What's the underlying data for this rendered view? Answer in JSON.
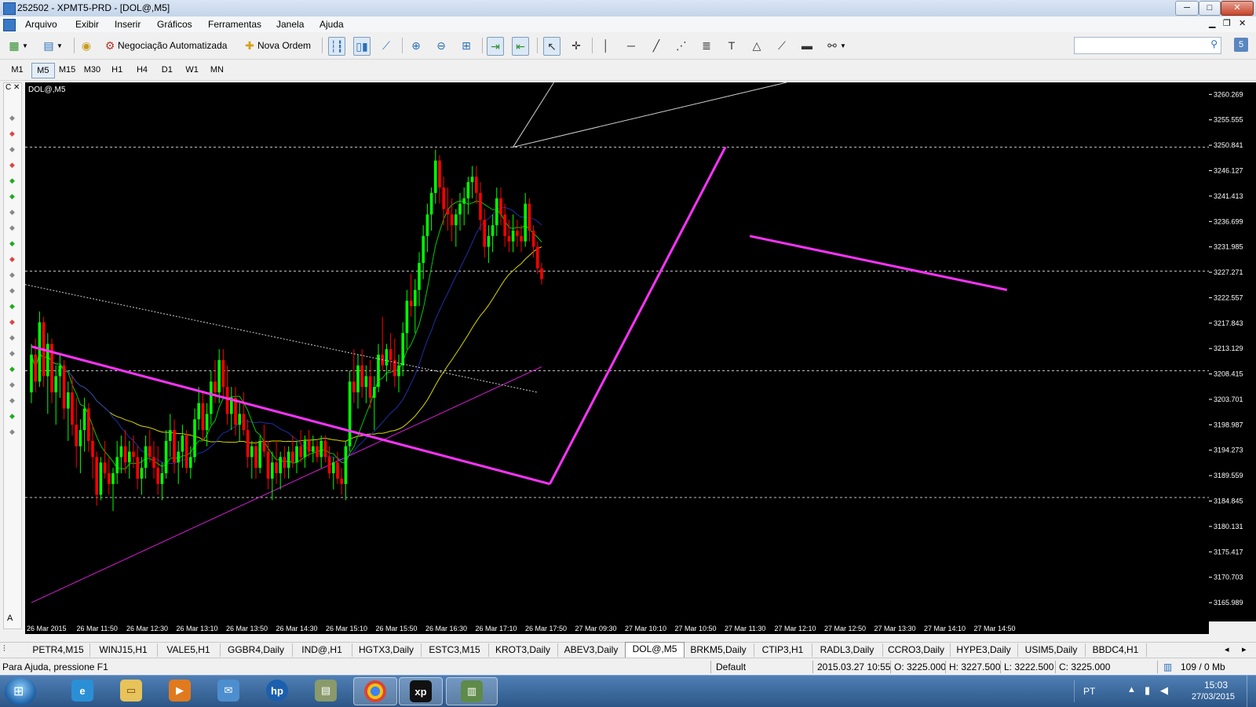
{
  "window": {
    "title": "252502 - XPMT5-PRD - [DOL@,M5]",
    "min_label": "─",
    "max_label": "□",
    "close_label": "✕"
  },
  "menu": [
    "Arquivo",
    "Exibir",
    "Inserir",
    "Gráficos",
    "Ferramentas",
    "Janela",
    "Ajuda"
  ],
  "toolbar": {
    "auto_trading_label": "Negociação Automatizada",
    "new_order_label": "Nova Ordem",
    "search_placeholder": ""
  },
  "timeframes": {
    "items": [
      "M1",
      "M5",
      "M15",
      "M30",
      "H1",
      "H4",
      "D1",
      "W1",
      "MN"
    ],
    "selected": "M5"
  },
  "chart_data": {
    "type": "candlestick",
    "symbol_label": "DOL@,M5",
    "y_ticks": [
      3260.269,
      3255.555,
      3250.841,
      3246.127,
      3241.413,
      3236.699,
      3231.985,
      3227.271,
      3222.557,
      3217.843,
      3213.129,
      3208.415,
      3203.701,
      3198.987,
      3194.273,
      3189.559,
      3184.845,
      3180.131,
      3175.417,
      3170.703,
      3165.989
    ],
    "ylim": [
      3162.5,
      3262.5
    ],
    "x_labels": [
      "26 Mar 2015",
      "26 Mar 11:50",
      "26 Mar 12:30",
      "26 Mar 13:10",
      "26 Mar 13:50",
      "26 Mar 14:30",
      "26 Mar 15:10",
      "26 Mar 15:50",
      "26 Mar 16:30",
      "26 Mar 17:10",
      "26 Mar 17:50",
      "27 Mar 09:30",
      "27 Mar 10:10",
      "27 Mar 10:50",
      "27 Mar 11:30",
      "27 Mar 12:10",
      "27 Mar 12:50",
      "27 Mar 13:30",
      "27 Mar 14:10",
      "27 Mar 14:50"
    ],
    "horizontal_levels": [
      3250.5,
      3227.5,
      3209.0,
      3185.5
    ],
    "colors": {
      "bull": "#00ff00",
      "bear": "#ff0000",
      "ma_fast": "#00cc00",
      "ma_mid": "#1e2fa8",
      "ma_slow": "#d8d800",
      "ma_long": "#d81ed8",
      "trend": "#ff33ff",
      "grid_dash": "#c0c0c0"
    },
    "trendlines": [
      {
        "name": "falling-trendline",
        "x": [
          0,
          127
        ],
        "y": [
          3213.5,
          3188.0
        ]
      },
      {
        "name": "rising-trendline",
        "x": [
          127,
          170
        ],
        "y": [
          3188.0,
          3250.5
        ]
      },
      {
        "name": "flag-trendline",
        "x": [
          176,
          239
        ],
        "y": [
          3234.0,
          3224.0
        ]
      }
    ],
    "candles_ohlc": [
      [
        3205,
        3214,
        3203,
        3212
      ],
      [
        3212,
        3215,
        3205,
        3207
      ],
      [
        3207,
        3220,
        3206,
        3218
      ],
      [
        3218,
        3219,
        3206,
        3208
      ],
      [
        3208,
        3216,
        3201,
        3214
      ],
      [
        3214,
        3215,
        3203,
        3205
      ],
      [
        3205,
        3210,
        3199,
        3208
      ],
      [
        3208,
        3212,
        3204,
        3210
      ],
      [
        3210,
        3211,
        3200,
        3202
      ],
      [
        3202,
        3207,
        3196,
        3205
      ],
      [
        3205,
        3208,
        3197,
        3199
      ],
      [
        3199,
        3204,
        3191,
        3195
      ],
      [
        3195,
        3200,
        3190,
        3198
      ],
      [
        3198,
        3204,
        3194,
        3202
      ],
      [
        3202,
        3203,
        3194,
        3196
      ],
      [
        3196,
        3199,
        3189,
        3193
      ],
      [
        3193,
        3194,
        3184,
        3186
      ],
      [
        3186,
        3193,
        3185,
        3192
      ],
      [
        3192,
        3196,
        3189,
        3190
      ],
      [
        3190,
        3193,
        3186,
        3188
      ],
      [
        3188,
        3191,
        3183,
        3190
      ],
      [
        3190,
        3196,
        3188,
        3193
      ],
      [
        3193,
        3197,
        3190,
        3195
      ],
      [
        3195,
        3198,
        3190,
        3192
      ],
      [
        3192,
        3196,
        3189,
        3194
      ],
      [
        3194,
        3197,
        3191,
        3193
      ],
      [
        3193,
        3195,
        3187,
        3189
      ],
      [
        3189,
        3193,
        3186,
        3191
      ],
      [
        3191,
        3197,
        3189,
        3195
      ],
      [
        3195,
        3198,
        3192,
        3193
      ],
      [
        3193,
        3196,
        3189,
        3191
      ],
      [
        3191,
        3195,
        3186,
        3188
      ],
      [
        3188,
        3192,
        3185,
        3190
      ],
      [
        3190,
        3198,
        3189,
        3196
      ],
      [
        3196,
        3201,
        3193,
        3198
      ],
      [
        3198,
        3200,
        3190,
        3192
      ],
      [
        3192,
        3196,
        3188,
        3194
      ],
      [
        3194,
        3199,
        3191,
        3197
      ],
      [
        3197,
        3198,
        3190,
        3191
      ],
      [
        3191,
        3195,
        3189,
        3193
      ],
      [
        3193,
        3202,
        3192,
        3200
      ],
      [
        3200,
        3206,
        3198,
        3203
      ],
      [
        3203,
        3205,
        3196,
        3198
      ],
      [
        3198,
        3203,
        3195,
        3201
      ],
      [
        3201,
        3209,
        3199,
        3207
      ],
      [
        3207,
        3211,
        3203,
        3205
      ],
      [
        3205,
        3213,
        3203,
        3211
      ],
      [
        3211,
        3213,
        3204,
        3206
      ],
      [
        3206,
        3210,
        3199,
        3201
      ],
      [
        3201,
        3206,
        3198,
        3204
      ],
      [
        3204,
        3206,
        3197,
        3199
      ],
      [
        3199,
        3203,
        3196,
        3201
      ],
      [
        3201,
        3205,
        3197,
        3198
      ],
      [
        3198,
        3200,
        3191,
        3193
      ],
      [
        3193,
        3196,
        3189,
        3195
      ],
      [
        3195,
        3196,
        3189,
        3191
      ],
      [
        3191,
        3197,
        3190,
        3196
      ],
      [
        3196,
        3199,
        3193,
        3194
      ],
      [
        3194,
        3196,
        3187,
        3189
      ],
      [
        3189,
        3194,
        3185,
        3192
      ],
      [
        3192,
        3196,
        3188,
        3190
      ],
      [
        3190,
        3194,
        3187,
        3193
      ],
      [
        3193,
        3195,
        3189,
        3191
      ],
      [
        3191,
        3195,
        3189,
        3194
      ],
      [
        3194,
        3197,
        3191,
        3192
      ],
      [
        3192,
        3196,
        3190,
        3195
      ],
      [
        3195,
        3198,
        3192,
        3193
      ],
      [
        3193,
        3197,
        3191,
        3196
      ],
      [
        3196,
        3198,
        3193,
        3194
      ],
      [
        3194,
        3197,
        3192,
        3195
      ],
      [
        3195,
        3196,
        3192,
        3193
      ],
      [
        3193,
        3197,
        3191,
        3196
      ],
      [
        3196,
        3197,
        3192,
        3193
      ],
      [
        3193,
        3195,
        3189,
        3190
      ],
      [
        3190,
        3193,
        3187,
        3192
      ],
      [
        3192,
        3194,
        3188,
        3189
      ],
      [
        3189,
        3191,
        3186,
        3188
      ],
      [
        3188,
        3196,
        3185,
        3195
      ],
      [
        3195,
        3209,
        3194,
        3207
      ],
      [
        3207,
        3213,
        3203,
        3205
      ],
      [
        3205,
        3212,
        3202,
        3210
      ],
      [
        3210,
        3213,
        3204,
        3206
      ],
      [
        3206,
        3210,
        3203,
        3208
      ],
      [
        3208,
        3211,
        3202,
        3204
      ],
      [
        3204,
        3208,
        3198,
        3206
      ],
      [
        3206,
        3214,
        3205,
        3212
      ],
      [
        3212,
        3219,
        3209,
        3210
      ],
      [
        3210,
        3214,
        3207,
        3213
      ],
      [
        3213,
        3216,
        3209,
        3211
      ],
      [
        3211,
        3215,
        3206,
        3208
      ],
      [
        3208,
        3212,
        3205,
        3210
      ],
      [
        3210,
        3218,
        3208,
        3216
      ],
      [
        3216,
        3224,
        3213,
        3222
      ],
      [
        3222,
        3227,
        3219,
        3221
      ],
      [
        3221,
        3226,
        3216,
        3224
      ],
      [
        3224,
        3231,
        3221,
        3229
      ],
      [
        3229,
        3236,
        3226,
        3234
      ],
      [
        3234,
        3240,
        3231,
        3238
      ],
      [
        3238,
        3243,
        3235,
        3242
      ],
      [
        3242,
        3250,
        3240,
        3248
      ],
      [
        3248,
        3249,
        3240,
        3243
      ],
      [
        3243,
        3245,
        3236,
        3239
      ],
      [
        3239,
        3243,
        3235,
        3238
      ],
      [
        3238,
        3241,
        3233,
        3236
      ],
      [
        3236,
        3239,
        3232,
        3238
      ],
      [
        3238,
        3242,
        3235,
        3240
      ],
      [
        3240,
        3243,
        3236,
        3241
      ],
      [
        3241,
        3245,
        3238,
        3244
      ],
      [
        3244,
        3247,
        3241,
        3245
      ],
      [
        3245,
        3247,
        3240,
        3242
      ],
      [
        3242,
        3244,
        3235,
        3237
      ],
      [
        3237,
        3239,
        3230,
        3232
      ],
      [
        3232,
        3236,
        3229,
        3234
      ],
      [
        3234,
        3238,
        3231,
        3236
      ],
      [
        3236,
        3243,
        3234,
        3241
      ],
      [
        3241,
        3243,
        3236,
        3238
      ],
      [
        3238,
        3240,
        3232,
        3234
      ],
      [
        3234,
        3237,
        3231,
        3233
      ],
      [
        3233,
        3238,
        3231,
        3235
      ],
      [
        3235,
        3237,
        3232,
        3234
      ],
      [
        3234,
        3236,
        3231,
        3233
      ],
      [
        3233,
        3242,
        3232,
        3240
      ],
      [
        3240,
        3241,
        3233,
        3235
      ],
      [
        3235,
        3236,
        3230,
        3232
      ],
      [
        3232,
        3233,
        3227,
        3228
      ],
      [
        3228,
        3229,
        3225,
        3226
      ]
    ]
  },
  "symbol_tabs": {
    "items": [
      "PETR4,M15",
      "WINJ15,H1",
      "VALE5,H1",
      "GGBR4,Daily",
      "IND@,H1",
      "HGTX3,Daily",
      "ESTC3,M15",
      "KROT3,Daily",
      "ABEV3,Daily",
      "DOL@,M5",
      "BRKM5,Daily",
      "CTIP3,H1",
      "RADL3,Daily",
      "CCRO3,Daily",
      "HYPE3,Daily",
      "USIM5,Daily",
      "BBDC4,H1"
    ],
    "active": "DOL@,M5"
  },
  "status": {
    "help": "Para Ajuda, pressione F1",
    "profile": "Default",
    "datetime": "2015.03.27 10:55",
    "open": "O: 3225.000",
    "high": "H: 3227.500",
    "low": "L: 3222.500",
    "close": "C: 3225.000",
    "traffic": "109 / 0 Mb"
  },
  "taskbar": {
    "apps": [
      "internet-explorer-icon",
      "explorer-icon",
      "media-player-icon",
      "mail-icon",
      "hp-icon",
      "tools-icon",
      "chrome-icon",
      "xp-icon",
      "metatrader-icon"
    ],
    "language": "PT",
    "time": "15:03",
    "date": "27/03/2015"
  }
}
